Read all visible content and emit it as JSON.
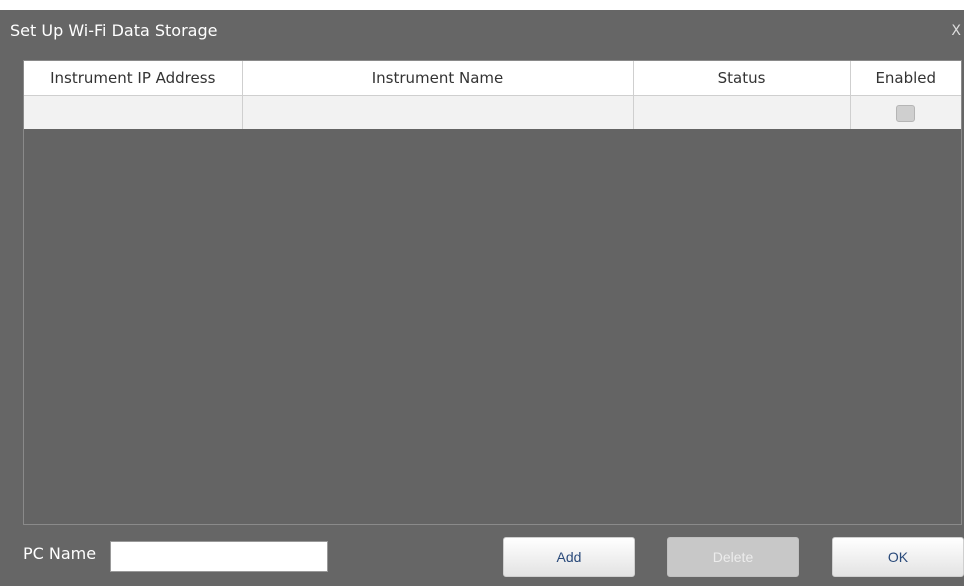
{
  "dialog": {
    "title": "Set Up Wi-Fi Data Storage",
    "close_label": "X"
  },
  "grid": {
    "columns": [
      {
        "key": "ip",
        "label": "Instrument IP Address"
      },
      {
        "key": "name",
        "label": "Instrument Name"
      },
      {
        "key": "status",
        "label": "Status"
      },
      {
        "key": "enabled",
        "label": "Enabled"
      }
    ],
    "rows": [
      {
        "ip": "",
        "name": "",
        "status": "",
        "enabled": false
      }
    ]
  },
  "footer": {
    "pc_name_label": "PC Name",
    "pc_name_value": "",
    "add_label": "Add",
    "delete_label": "Delete",
    "ok_label": "OK"
  },
  "colors": {
    "dialog_bg": "#666666",
    "header_bg": "#ffffff",
    "row_bg": "#f2f2f2",
    "button_text": "#2a4a7a",
    "disabled_button": "#c8c8c8"
  }
}
